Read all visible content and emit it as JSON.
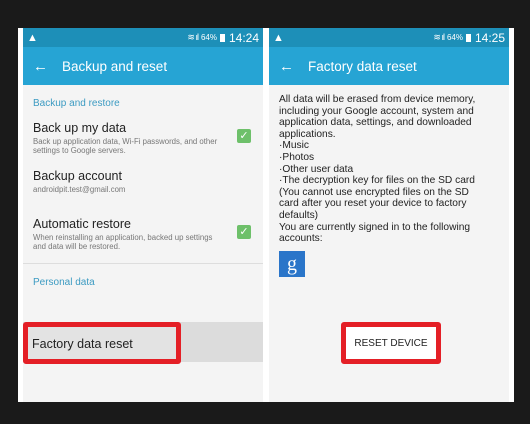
{
  "left": {
    "status": {
      "warn": "▲",
      "battery": "64%",
      "time": "14:24"
    },
    "appbar": {
      "title": "Backup and reset"
    },
    "section1": "Backup and restore",
    "items": [
      {
        "title": "Back up my data",
        "desc": "Back up application data, Wi-Fi passwords, and other settings to Google servers."
      },
      {
        "title": "Backup account",
        "desc": "androidpit.test@gmail.com"
      },
      {
        "title": "Automatic restore",
        "desc": "When reinstalling an application, backed up settings and data will be restored."
      }
    ],
    "section2": "Personal data",
    "factory": "Factory data reset"
  },
  "right": {
    "status": {
      "warn": "▲",
      "battery": "64%",
      "time": "14:25"
    },
    "appbar": {
      "title": "Factory data reset"
    },
    "lines": [
      "All data will be erased from device memory,",
      "including your Google account, system and",
      "application data, settings, and downloaded",
      "applications."
    ],
    "bullets": [
      "·Music",
      "·Photos",
      "·Other user data",
      "·The decryption key for files on the SD card",
      " (You cannot use encrypted files on the SD",
      " card after you reset your device to factory",
      " defaults)"
    ],
    "signed": [
      "You are currently signed in to the following",
      "accounts:"
    ],
    "google_letter": "g",
    "reset_button": "RESET DEVICE"
  },
  "colors": {
    "statusbar": "#1d8fb8",
    "appbar": "#26a4d4",
    "highlight": "#e41f26",
    "check": "#6ec06a"
  }
}
